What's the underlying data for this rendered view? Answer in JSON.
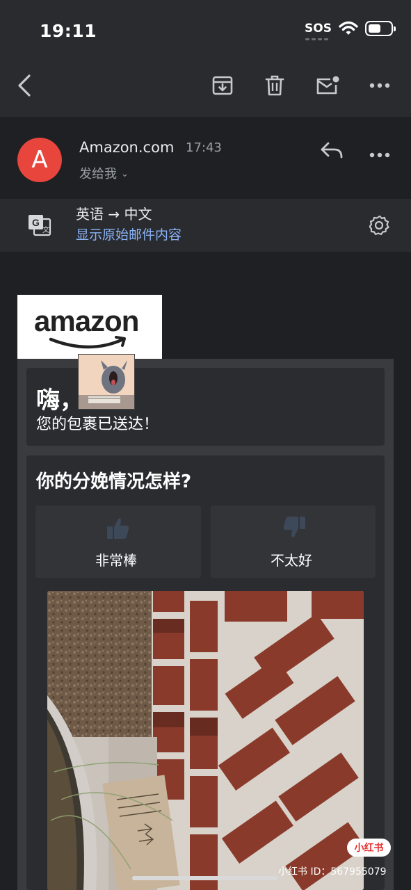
{
  "status_bar": {
    "time": "19:11",
    "sos": "SOS",
    "icons": [
      "wifi-icon",
      "battery-icon"
    ]
  },
  "toolbar": {
    "icons": [
      "back-icon",
      "archive-icon",
      "trash-icon",
      "mark-unread-icon",
      "more-icon"
    ]
  },
  "email_header": {
    "avatar_letter": "A",
    "sender": "Amazon.com",
    "time": "17:43",
    "recipient": "发给我",
    "icons": [
      "reply-icon",
      "more-icon"
    ]
  },
  "translate": {
    "languages": "英语 → 中文",
    "show_original": "显示原始邮件内容",
    "icons": [
      "translate-icon",
      "settings-icon"
    ]
  },
  "email_body": {
    "logo_text": "amazon",
    "greeting_title": "嗨，",
    "greeting_sub": "您的包裹已送达！",
    "question": "你的分娩情况怎样?",
    "good_label": "非常棒",
    "bad_label": "不太好"
  },
  "watermark": {
    "badge": "小红书",
    "id_text": "小红书 ID：567955079"
  },
  "colors": {
    "background": "#1f2024",
    "bar": "#2a2b2f",
    "link": "#8ab4f8",
    "avatar": "#e8453c",
    "badge_red": "#e82e2e"
  }
}
